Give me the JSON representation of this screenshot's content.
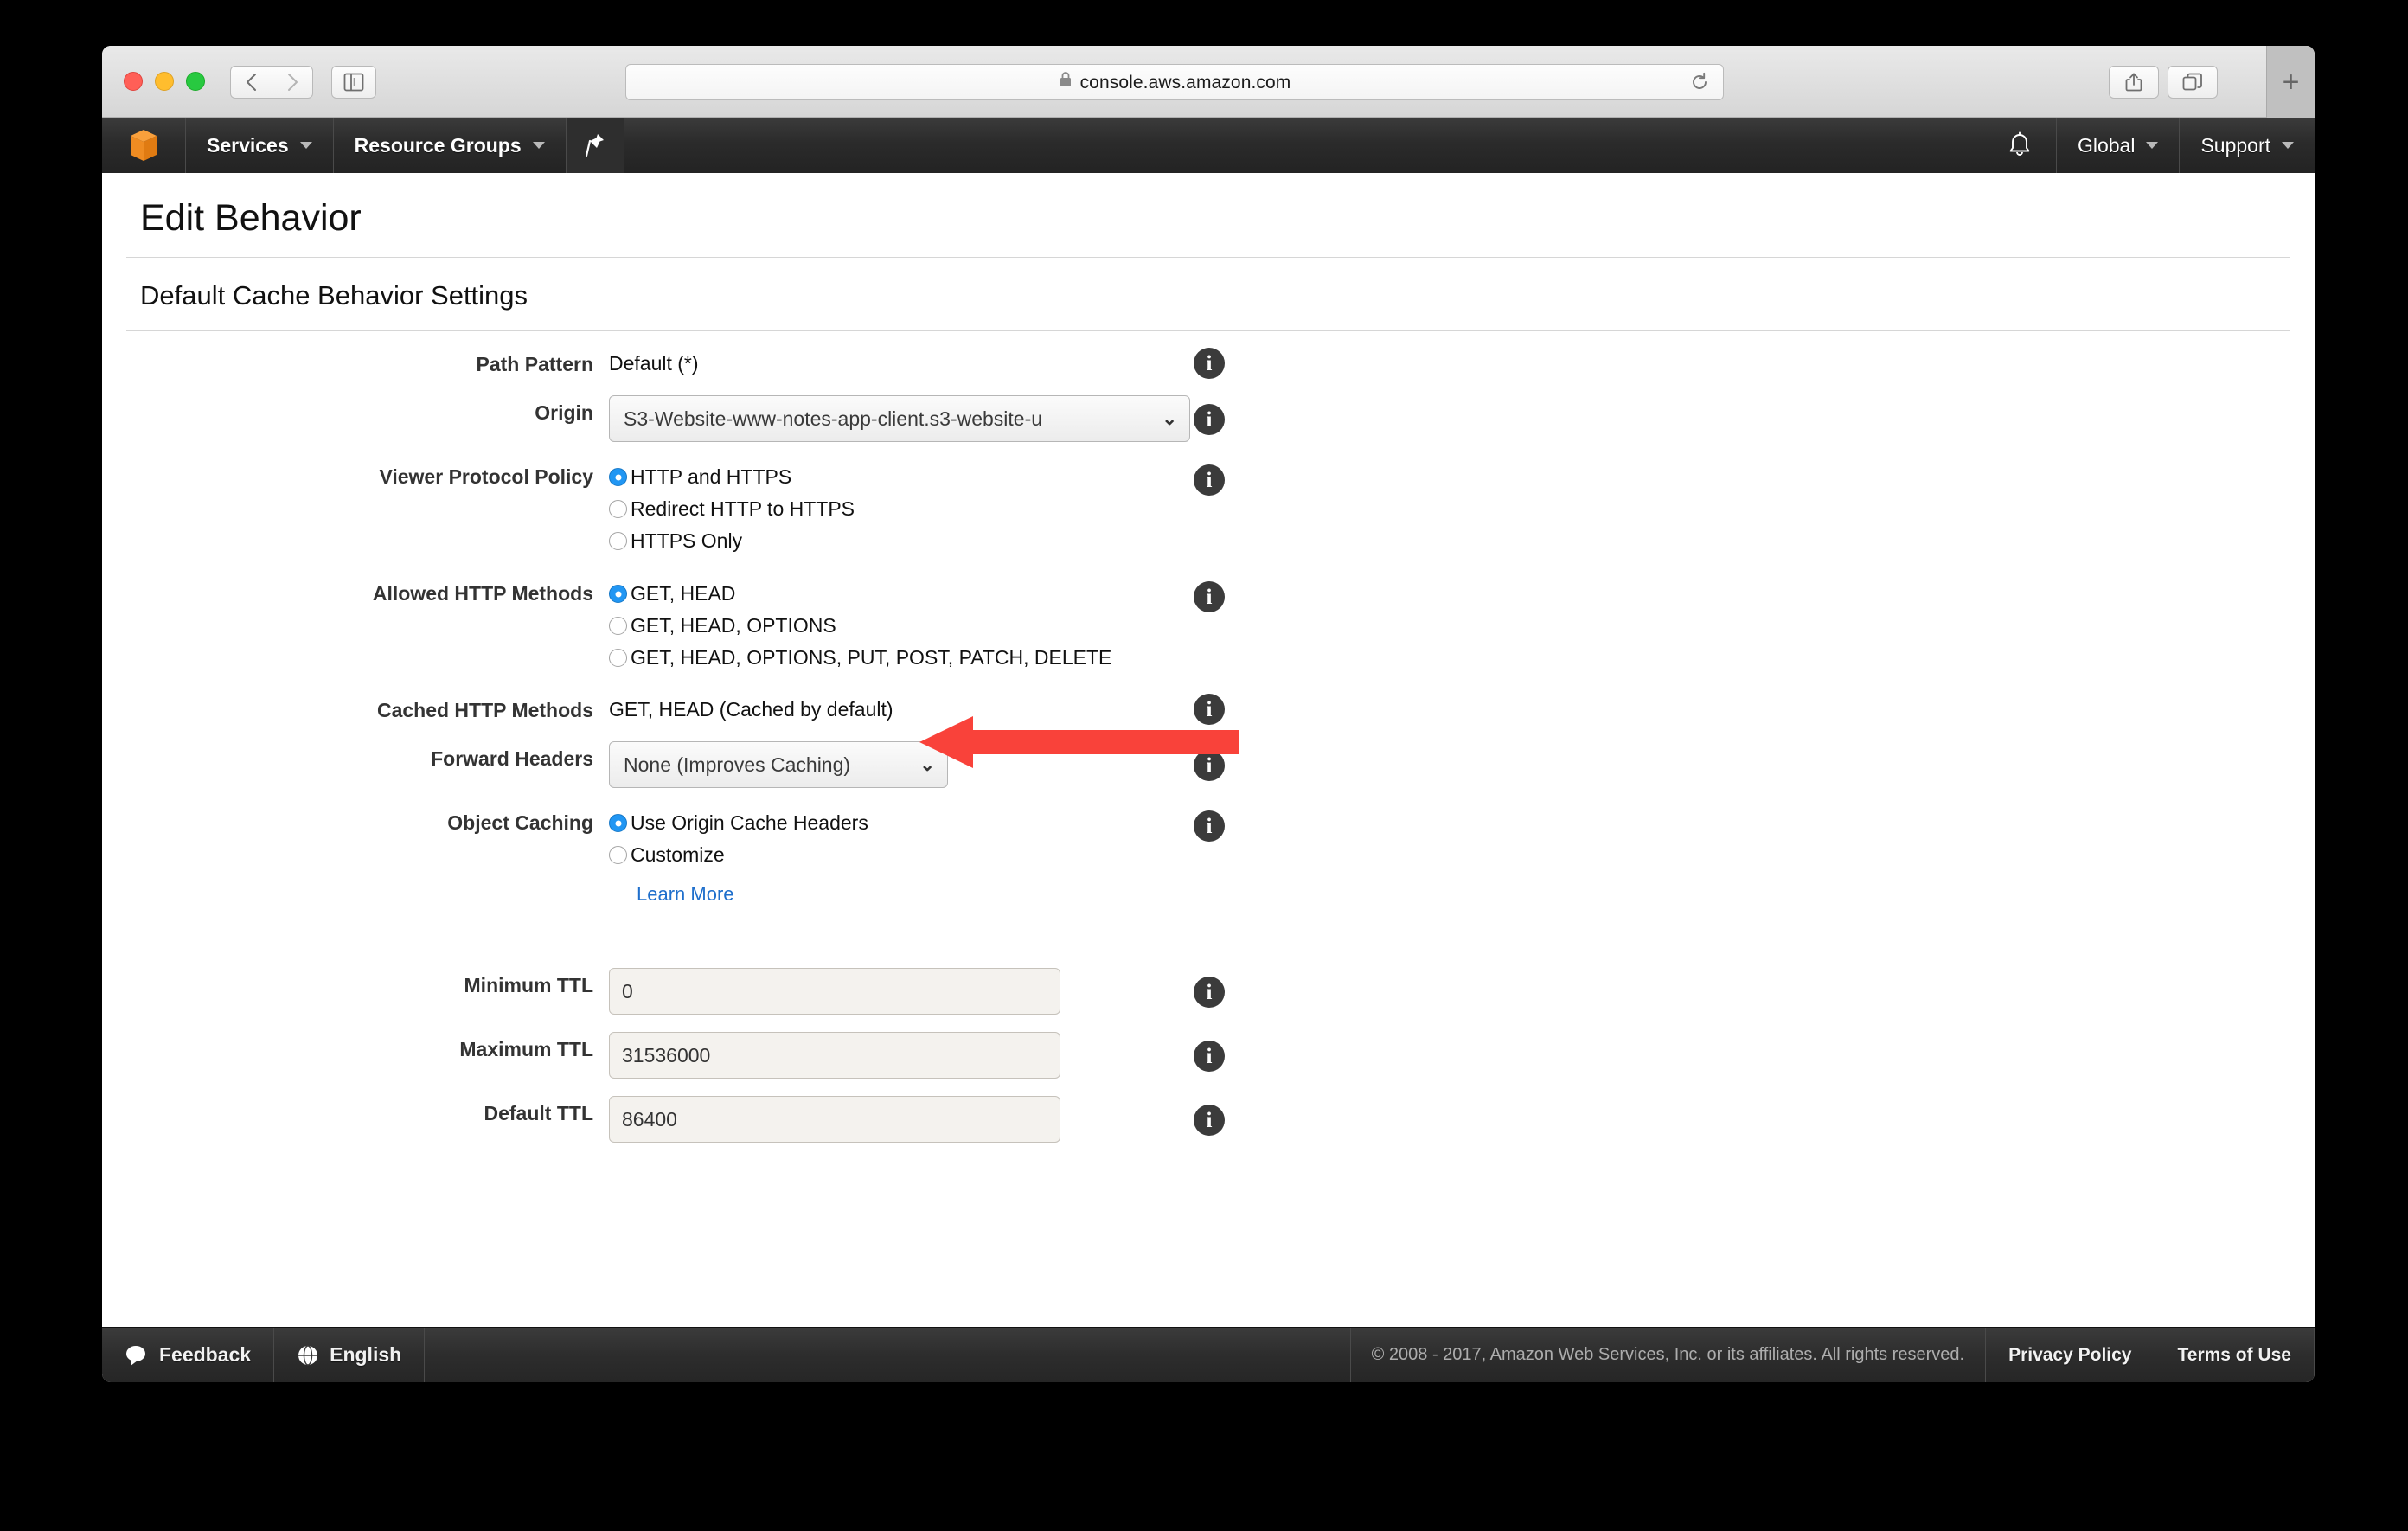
{
  "browser": {
    "url": "console.aws.amazon.com",
    "lock_icon": "lock-icon",
    "reload_icon": "reload-icon",
    "back_icon": "chevron-left-icon",
    "forward_icon": "chevron-right-icon",
    "sidebar_icon": "sidebar-panel-icon",
    "share_icon": "share-icon",
    "tabs_icon": "tab-overview-icon",
    "new_tab_label": "+"
  },
  "navbar": {
    "logo_icon": "aws-cube-logo",
    "services_label": "Services",
    "resource_groups_label": "Resource Groups",
    "pin_icon": "pin-icon",
    "bell_icon": "bell-icon",
    "region_label": "Global",
    "support_label": "Support"
  },
  "page": {
    "title": "Edit Behavior",
    "section_title": "Default Cache Behavior Settings"
  },
  "form": {
    "path_pattern": {
      "label": "Path Pattern",
      "value": "Default (*)"
    },
    "origin": {
      "label": "Origin",
      "value": "S3-Website-www-notes-app-client.s3-website-u",
      "caret": "⌄"
    },
    "viewer_protocol_policy": {
      "label": "Viewer Protocol Policy",
      "options": [
        {
          "label": "HTTP and HTTPS",
          "checked": true
        },
        {
          "label": "Redirect HTTP to HTTPS",
          "checked": false
        },
        {
          "label": "HTTPS Only",
          "checked": false
        }
      ]
    },
    "allowed_http_methods": {
      "label": "Allowed HTTP Methods",
      "options": [
        {
          "label": "GET, HEAD",
          "checked": true
        },
        {
          "label": "GET, HEAD, OPTIONS",
          "checked": false
        },
        {
          "label": "GET, HEAD, OPTIONS, PUT, POST, PATCH, DELETE",
          "checked": false
        }
      ]
    },
    "cached_http_methods": {
      "label": "Cached HTTP Methods",
      "value": "GET, HEAD (Cached by default)"
    },
    "forward_headers": {
      "label": "Forward Headers",
      "value": "None (Improves Caching)"
    },
    "object_caching": {
      "label": "Object Caching",
      "options": [
        {
          "label": "Use Origin Cache Headers",
          "checked": true
        },
        {
          "label": "Customize",
          "checked": false
        }
      ],
      "learn_more_label": "Learn More"
    },
    "minimum_ttl": {
      "label": "Minimum TTL",
      "value": "0"
    },
    "maximum_ttl": {
      "label": "Maximum TTL",
      "value": "31536000"
    },
    "default_ttl": {
      "label": "Default TTL",
      "value": "86400"
    },
    "info_glyph": "i"
  },
  "annotation": {
    "arrow_color": "#f9423a",
    "arrow_direction": "left",
    "points_at": "HTTP and HTTPS"
  },
  "footer": {
    "feedback_label": "Feedback",
    "feedback_icon": "speech-bubble-icon",
    "language_label": "English",
    "language_icon": "globe-icon",
    "copyright": "© 2008 - 2017, Amazon Web Services, Inc. or its affiliates. All rights reserved.",
    "privacy_policy_label": "Privacy Policy",
    "terms_of_use_label": "Terms of Use"
  },
  "colors": {
    "aws_orange": "#f28b23",
    "nav_dark": "#2b2b2b",
    "accent_blue": "#2196f3",
    "link_blue": "#1f6fcc",
    "annotation_red": "#f9423a"
  }
}
